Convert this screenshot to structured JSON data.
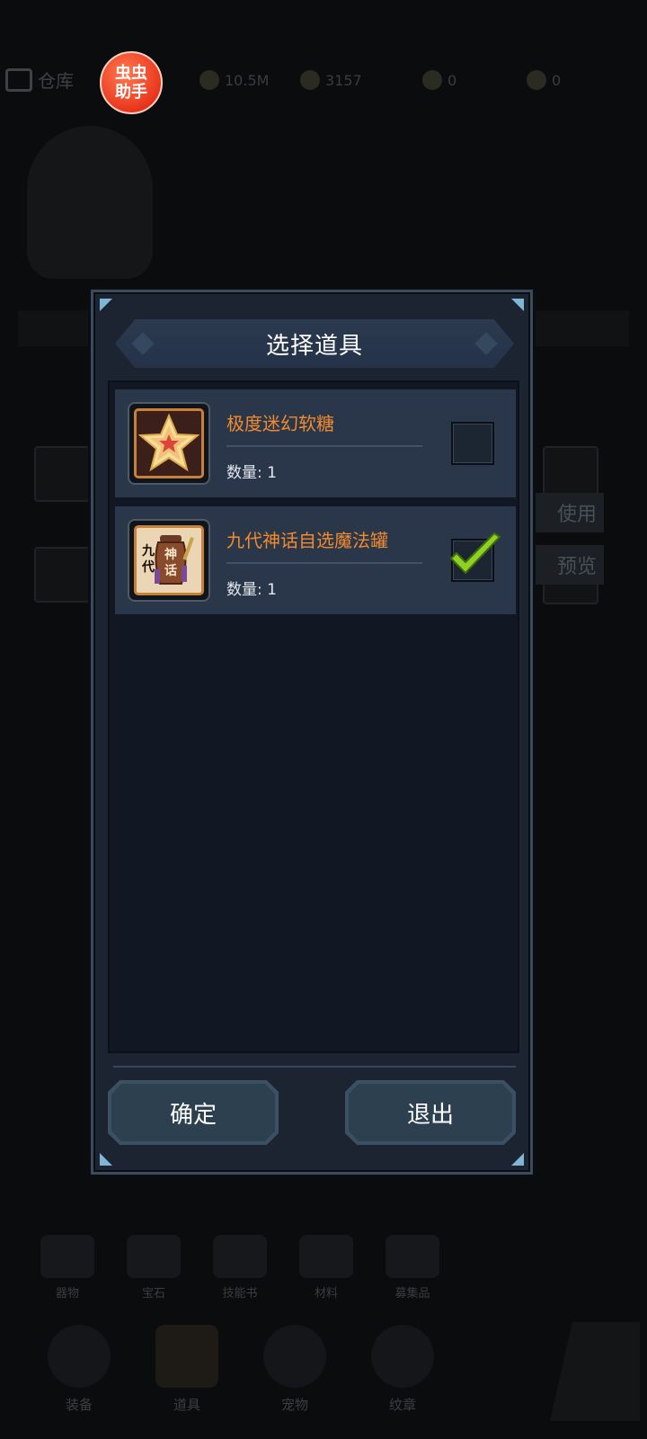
{
  "background": {
    "header_title": "仓库",
    "resources": [
      "10.5M",
      "3157",
      "0",
      "0"
    ],
    "side_buttons": [
      "使用",
      "预览"
    ],
    "bottom_tiles": [
      "器物",
      "宝石",
      "技能书",
      "材料",
      "募集品"
    ],
    "nav_tabs": [
      "装备",
      "道具",
      "宠物",
      "纹章"
    ]
  },
  "helper_badge": {
    "label": "虫虫助手"
  },
  "dialog": {
    "title": "选择道具",
    "items": [
      {
        "name": "极度迷幻软糖",
        "quantity_label": "数量: 1",
        "icon": "star-candy-icon",
        "checked": false
      },
      {
        "name": "九代神话自选魔法罐",
        "quantity_label": "数量: 1",
        "icon": "magic-jar-icon",
        "icon_text": [
          "九",
          "代",
          "神",
          "话"
        ],
        "checked": true
      }
    ],
    "confirm_label": "确定",
    "exit_label": "退出"
  },
  "colors": {
    "item_name": "#f28a2e",
    "dialog_bg": "#1c2431",
    "check_green": "#8fd123"
  }
}
